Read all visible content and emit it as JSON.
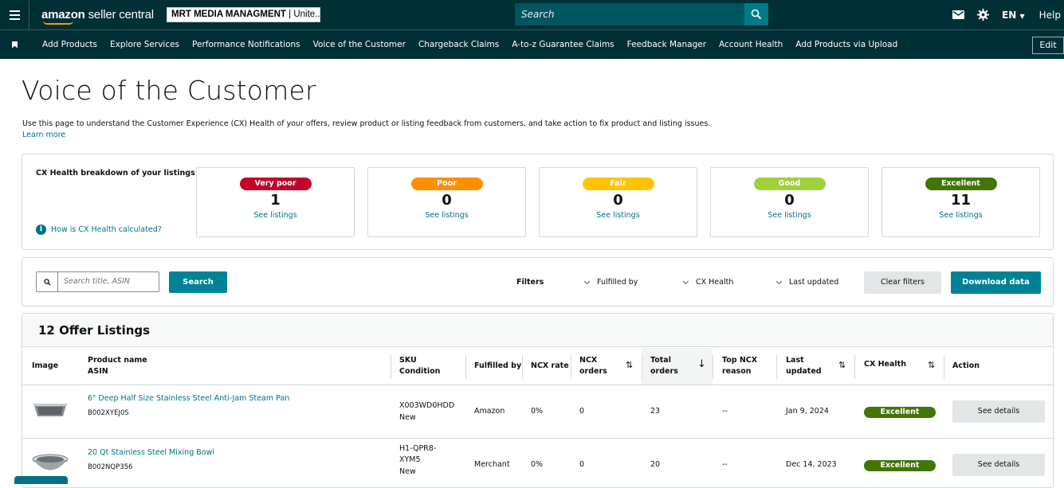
{
  "topbar": {
    "logo_main": "amazon",
    "logo_sub": "seller central",
    "store_name": "MRT MEDIA MANAGMENT",
    "store_region": "Unite...",
    "search_placeholder": "Search",
    "language": "EN",
    "help": "Help",
    "icons": [
      "menu-icon",
      "mail-icon",
      "gear-icon",
      "search-icon"
    ]
  },
  "nav": {
    "items": [
      "Add Products",
      "Explore Services",
      "Performance Notifications",
      "Voice of the Customer",
      "Chargeback Claims",
      "A-to-z Guarantee Claims",
      "Feedback Manager",
      "Account Health",
      "Add Products via Upload"
    ],
    "edit": "Edit"
  },
  "page": {
    "title": "Voice of the Customer",
    "description": "Use this page to understand the Customer Experience (CX) Health of your offers, review product or listing feedback from customers, and take action to fix product and listing issues.",
    "learn_more": "Learn more"
  },
  "cx": {
    "title": "CX Health breakdown of your listings",
    "how_link": "How is CX Health calculated?",
    "tiles": [
      {
        "label": "Very poor",
        "count": "1",
        "link": "See listings",
        "color": "#c40029"
      },
      {
        "label": "Poor",
        "count": "0",
        "link": "See listings",
        "color": "#ff8f00"
      },
      {
        "label": "Fair",
        "count": "0",
        "link": "See listings",
        "color": "#ffc400"
      },
      {
        "label": "Good",
        "count": "0",
        "link": "See listings",
        "color": "#9ed23c"
      },
      {
        "label": "Excellent",
        "count": "11",
        "link": "See listings",
        "color": "#417505"
      }
    ]
  },
  "filters": {
    "search_placeholder": "Search title, ASIN",
    "search_button": "Search",
    "label": "Filters",
    "fulfilled_by": "Fulfilled by",
    "cx_health": "CX Health",
    "last_updated": "Last updated",
    "clear": "Clear filters",
    "download": "Download data"
  },
  "listings": {
    "title": "12 Offer Listings",
    "columns": {
      "image": "Image",
      "product_name": "Product name",
      "asin": "ASIN",
      "sku": "SKU",
      "condition": "Condition",
      "fulfilled_by": "Fulfilled by",
      "ncx_rate": "NCX rate",
      "ncx_orders_1": "NCX",
      "ncx_orders_2": "orders",
      "total_orders_1": "Total",
      "total_orders_2": "orders",
      "top_ncx_1": "Top NCX",
      "top_ncx_2": "reason",
      "last_updated_1": "Last",
      "last_updated_2": "updated",
      "cx_health": "CX Health",
      "action": "Action"
    },
    "rows": [
      {
        "name": "6\" Deep Half Size Stainless Steel Anti-Jam Steam Pan",
        "asin": "B002XYEJ0S",
        "sku": "X003WD0HDD",
        "sku_2": "",
        "sku_3": "",
        "condition": "New",
        "fulfilled_by": "Amazon",
        "ncx_rate": "0%",
        "ncx_orders": "0",
        "total_orders": "23",
        "top_ncx": "--",
        "last_updated": "Jan 9, 2024",
        "cx_health": "Excellent",
        "action": "See details"
      },
      {
        "name": "20 Qt Stainless Steel Mixing Bowl",
        "asin": "B002NQP356",
        "sku": "H1-QPR8-",
        "sku_2": "XYM5",
        "condition": "New",
        "fulfilled_by": "Merchant",
        "ncx_rate": "0%",
        "ncx_orders": "0",
        "total_orders": "20",
        "top_ncx": "--",
        "last_updated": "Dec 14, 2023",
        "cx_health": "Excellent",
        "action": "See details"
      }
    ]
  }
}
